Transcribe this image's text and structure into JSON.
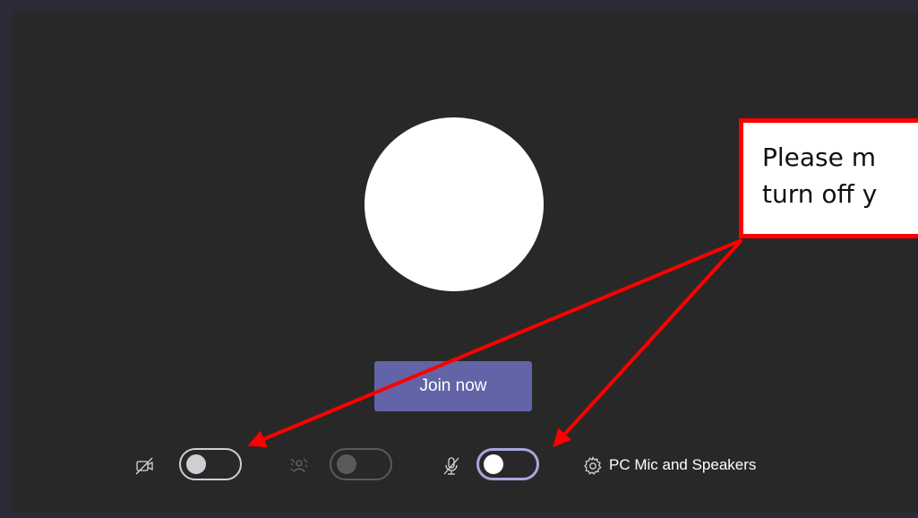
{
  "pre_join": {
    "join_button_label": "Join now",
    "audio_device_label": "PC Mic and Speakers",
    "controls": [
      {
        "name": "camera",
        "icon": "camera-off-icon",
        "state": "off"
      },
      {
        "name": "background-effects",
        "icon": "background-blur-icon",
        "state": "disabled"
      },
      {
        "name": "microphone",
        "icon": "mic-off-icon",
        "state": "off"
      },
      {
        "name": "device-settings",
        "icon": "gear-icon"
      }
    ]
  },
  "annotation": {
    "line1": "Please m",
    "line2": "turn off y",
    "border_color": "#ff0000",
    "arrow_color": "#ff0000"
  },
  "colors": {
    "page_frame": "#2b2b37",
    "stage_background": "#282828",
    "join_button": "#6264a7",
    "toggle_focus": "#a6a7dc"
  }
}
